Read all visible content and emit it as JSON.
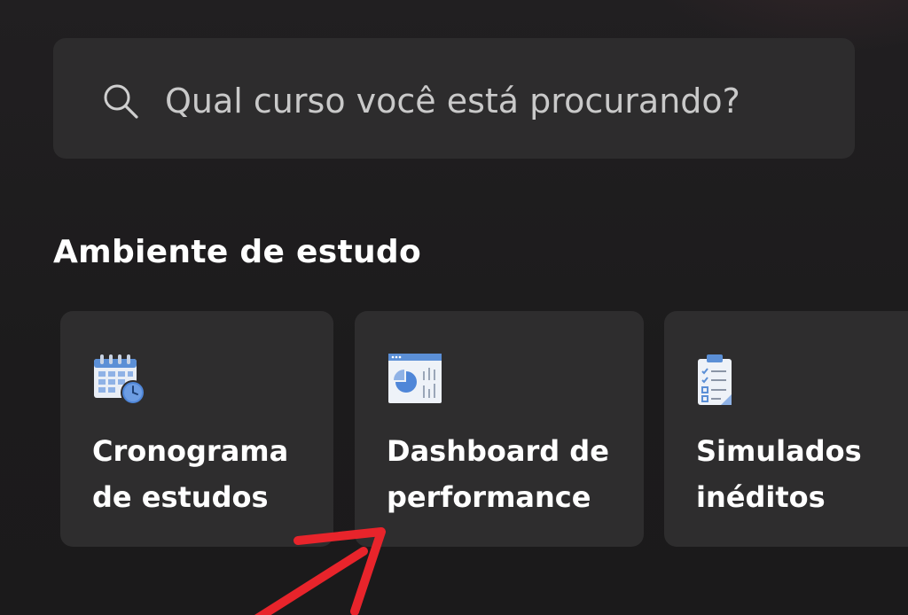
{
  "search": {
    "placeholder": "Qual curso você está procurando?",
    "icon": "search-icon"
  },
  "section": {
    "title": "Ambiente de estudo"
  },
  "cards": [
    {
      "label": "Cronograma\nde estudos",
      "icon": "calendar-clock-icon"
    },
    {
      "label": "Dashboard de\nperformance",
      "icon": "dashboard-chart-icon"
    },
    {
      "label": "Simulados\ninéditos",
      "icon": "clipboard-checklist-icon"
    }
  ],
  "colors": {
    "background": "#1d1c1d",
    "surface": "#2e2d2e",
    "text": "#ffffff",
    "accent_blue": "#5b8fd6",
    "annotation_arrow": "#e8242b"
  }
}
